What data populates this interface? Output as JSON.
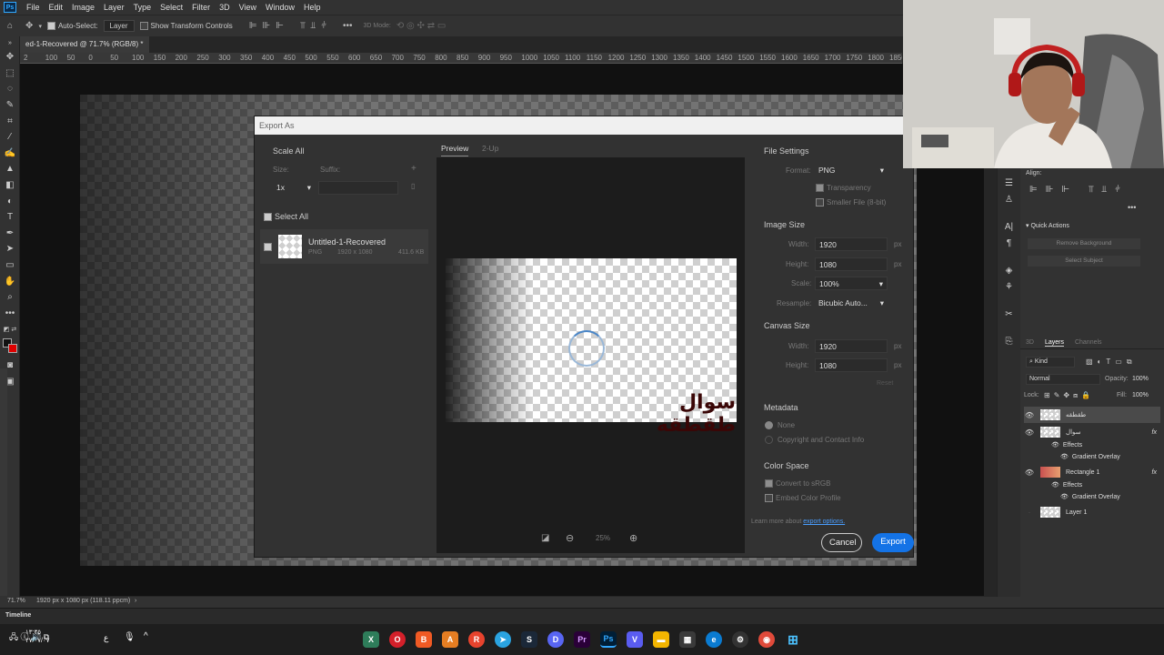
{
  "menubar": {
    "logo": "Ps",
    "items": [
      "File",
      "Edit",
      "Image",
      "Layer",
      "Type",
      "Select",
      "Filter",
      "3D",
      "View",
      "Window",
      "Help"
    ]
  },
  "optbar": {
    "auto_select": "Auto-Select:",
    "layer_select": "Layer",
    "transform": "Show Transform Controls",
    "mode3d": "3D Mode:"
  },
  "document_tab": "ed-1-Recovered @ 71.7% (RGB/8) *",
  "ruler_ticks": [
    "2",
    "100",
    "50",
    "0",
    "50",
    "100",
    "150",
    "200",
    "250",
    "300",
    "350",
    "400",
    "450",
    "500",
    "550",
    "600",
    "650",
    "700",
    "750",
    "800",
    "850",
    "900",
    "950",
    "1000",
    "1050",
    "1100",
    "1150",
    "1200",
    "1250",
    "1300",
    "1350",
    "1400",
    "1450",
    "1500",
    "1550",
    "1600",
    "1650",
    "1700",
    "1750",
    "1800",
    "1850"
  ],
  "dialog": {
    "title": "Export As",
    "scale_all": "Scale All",
    "size_label": "Size:",
    "suffix_label": "Suffix:",
    "scale_value": "1x",
    "select_all": "Select All",
    "asset_name": "Untitled-1-Recovered",
    "asset_format": "PNG",
    "asset_dims": "1920 x 1080",
    "asset_size": "411.6 KB",
    "tab_preview": "Preview",
    "tab_2up": "2-Up",
    "arabic_text": "سوال طقطقه",
    "zoom": "25%",
    "file_settings": "File Settings",
    "format_label": "Format:",
    "format_value": "PNG",
    "transparency": "Transparency",
    "smaller_file": "Smaller File (8-bit)",
    "image_size": "Image Size",
    "width_label": "Width:",
    "width_value": "1920",
    "height_label": "Height:",
    "height_value": "1080",
    "px": "px",
    "scale_label": "Scale:",
    "scale_pct": "100%",
    "resample_label": "Resample:",
    "resample_value": "Bicubic Auto...",
    "canvas_size": "Canvas Size",
    "canvas_width": "1920",
    "canvas_height": "1080",
    "reset": "Reset",
    "metadata": "Metadata",
    "meta_none": "None",
    "meta_copyright": "Copyright and Contact Info",
    "color_space": "Color Space",
    "convert_srgb": "Convert to sRGB",
    "embed_profile": "Embed Color Profile",
    "learn_more": "Learn more about",
    "export_options": "export options.",
    "cancel": "Cancel",
    "export": "Export"
  },
  "right_panel": {
    "align": "Align:",
    "quick_actions": "Quick Actions",
    "remove_bg": "Remove Background",
    "select_subject": "Select Subject",
    "tabs": [
      "3D",
      "Layers",
      "Channels"
    ],
    "kind": "Kind",
    "blend": "Normal",
    "opacity_label": "Opacity:",
    "opacity": "100%",
    "lock_label": "Lock:",
    "fill_label": "Fill:",
    "fill": "100%",
    "layers": [
      {
        "name": "طقطقه",
        "thumb": "checker",
        "fx": false
      },
      {
        "name": "سوال",
        "thumb": "checker",
        "fx": true
      },
      {
        "name": "Effects",
        "thumb": "none",
        "fx": false,
        "indent": 1
      },
      {
        "name": "Gradient Overlay",
        "thumb": "none",
        "fx": false,
        "indent": 2
      },
      {
        "name": "Rectangle 1",
        "thumb": "red",
        "fx": true
      },
      {
        "name": "Effects",
        "thumb": "none",
        "fx": false,
        "indent": 1
      },
      {
        "name": "Gradient Overlay",
        "thumb": "none",
        "fx": false,
        "indent": 2
      },
      {
        "name": "Layer 1",
        "thumb": "checker",
        "fx": false
      }
    ],
    "fx": "fx"
  },
  "status": {
    "zoom": "71.7%",
    "doc": "1920 px x 1080 px (118.11 ppcm)"
  },
  "timeline": "Timeline",
  "taskbar": {
    "clock": "١٣:٣٥",
    "date": "٢٧/٠٧/٠٧",
    "lang": "ع",
    "apps": [
      "W",
      "O",
      "B",
      "A",
      "R",
      "T",
      "S",
      "D",
      "Pr",
      "Ps",
      "V",
      "F",
      "St",
      "E",
      "C",
      "G",
      "Win"
    ]
  },
  "colors": {
    "accent": "#1473e6",
    "ps_blue": "#31a8ff",
    "panel": "#323232",
    "bg": "#262626"
  }
}
